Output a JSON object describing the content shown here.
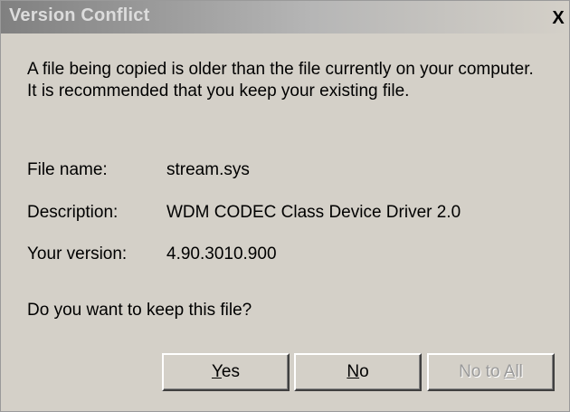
{
  "window": {
    "title": "Version Conflict",
    "close_label": "X"
  },
  "message": "A file being copied is older than the file currently on your computer. It is recommended that you keep your existing file.",
  "fields": [
    {
      "label": "File name:",
      "value": "stream.sys"
    },
    {
      "label": "Description:",
      "value": "WDM CODEC Class Device Driver 2.0"
    },
    {
      "label": "Your version:",
      "value": "4.90.3010.900"
    }
  ],
  "question": "Do you want to keep this file?",
  "buttons": {
    "yes": {
      "accel": "Y",
      "rest": "es"
    },
    "no": {
      "accel": "N",
      "rest": "o"
    },
    "no_to_all": {
      "prefix": "No to ",
      "accel": "A",
      "rest": "ll",
      "enabled": false
    }
  },
  "colors": {
    "dialog_bg": "#d4d0c8",
    "title_text": "#dcdcdc",
    "disabled_text": "#9a9a9a"
  }
}
